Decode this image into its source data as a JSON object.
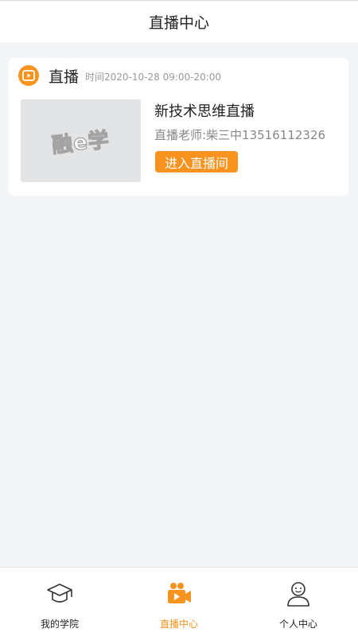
{
  "header": {
    "title": "直播中心"
  },
  "live_card": {
    "title": "直播",
    "time": "时间2020-10-28 09:00-20:00",
    "thumbnail_logo": "融e学",
    "course_title": "新技术思维直播",
    "teacher": "直播老师:柴三中13516112326",
    "enter_label": "进入直播间"
  },
  "tabbar": {
    "tabs": [
      {
        "label": "我的学院",
        "icon": "graduation-cap-icon",
        "active": false
      },
      {
        "label": "直播中心",
        "icon": "video-camera-icon",
        "active": true
      },
      {
        "label": "个人中心",
        "icon": "user-icon",
        "active": false
      }
    ]
  },
  "colors": {
    "accent": "#f7931e",
    "background": "#f4f5f7"
  }
}
